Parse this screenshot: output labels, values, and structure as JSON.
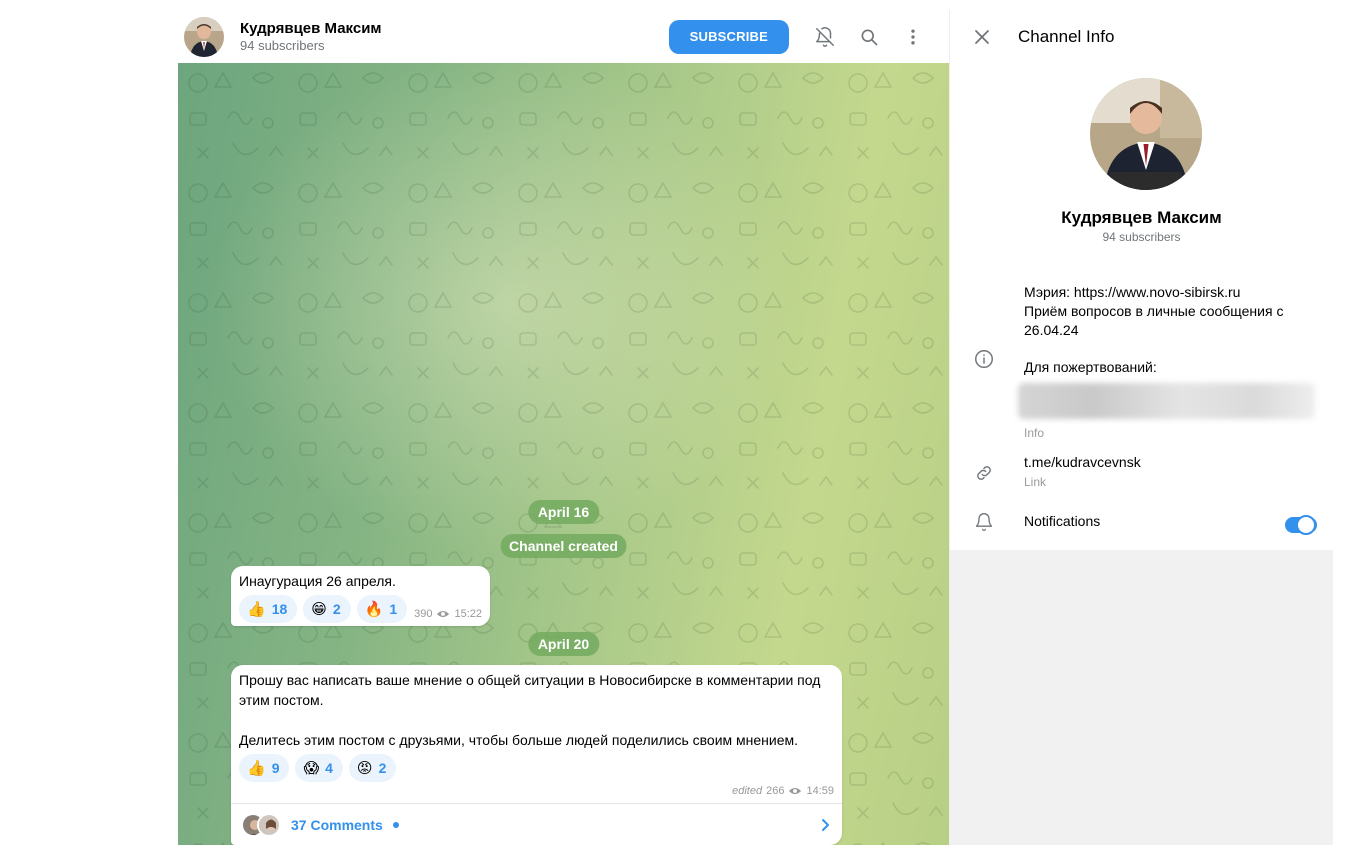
{
  "chat_header": {
    "title": "Кудрявцев Максим",
    "subtitle": "94 subscribers",
    "subscribe_label": "SUBSCRIBE",
    "icons": [
      "bell-off-icon",
      "search-icon",
      "more-vertical-icon"
    ]
  },
  "messages": {
    "date1": "April 16",
    "service1": "Channel created",
    "msg1": {
      "text": "Инаугурация 26 апреля.",
      "reactions": [
        {
          "emoji": "👍",
          "count": "18"
        },
        {
          "emoji": "😁",
          "count": "2"
        },
        {
          "emoji": "🔥",
          "count": "1"
        }
      ],
      "views": "390",
      "time": "15:22"
    },
    "date2": "April 20",
    "msg2": {
      "text": "Прошу вас написать ваше мнение о общей ситуации в Новосибирске в комментарии под этим постом.\n\nДелитесь этим постом с друзьями, чтобы больше людей поделились своим мнением.",
      "reactions": [
        {
          "emoji": "👍",
          "count": "9"
        },
        {
          "emoji": "😱",
          "count": "4"
        },
        {
          "emoji": "😡",
          "count": "2"
        }
      ],
      "edited": "edited",
      "views": "266",
      "time": "14:59",
      "comments_label": "37 Comments"
    }
  },
  "info_panel": {
    "title": "Channel Info",
    "name": "Кудрявцев Максим",
    "subscribers": "94 subscribers",
    "description": "Мэрия: https://www.novo-sibirsk.ru\nПриём вопросов в личные сообщения с 26.04.24",
    "donations_label": "Для пожертвований:",
    "info_caption": "Info",
    "link": "t.me/kudravcevnsk",
    "link_caption": "Link",
    "notifications_label": "Notifications",
    "notifications_on": true
  },
  "colors": {
    "accent": "#3390ec",
    "secondary_text": "#707579",
    "panel_bg": "#f1f1f1"
  }
}
